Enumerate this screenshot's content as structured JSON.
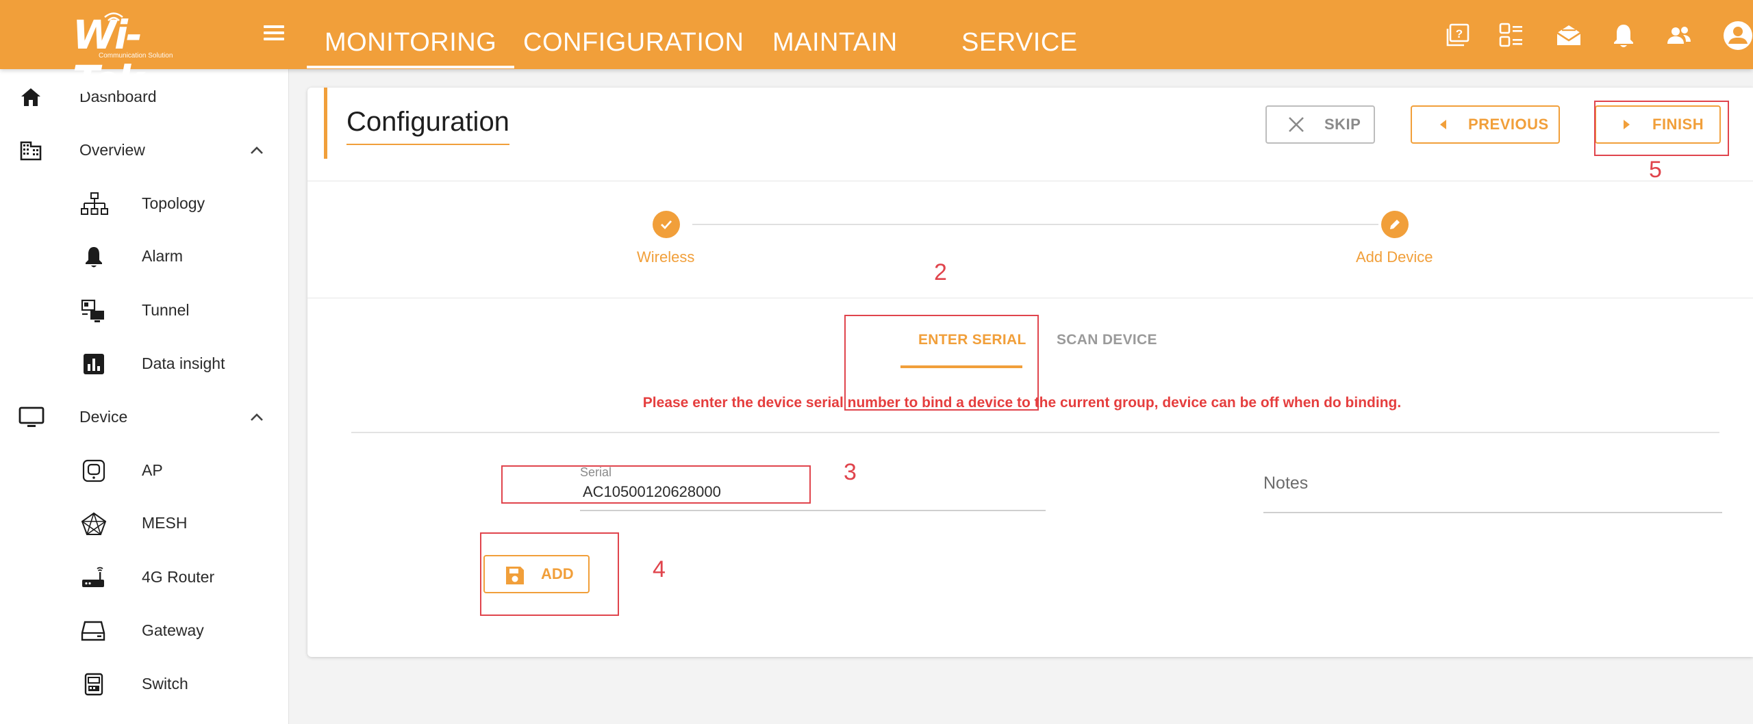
{
  "app": {
    "logo_text": "Wi-Tek",
    "logo_tagline": "Communication Solution"
  },
  "topnav": {
    "items": [
      {
        "label": "MONITORING",
        "active": true
      },
      {
        "label": "CONFIGURATION",
        "active": false
      },
      {
        "label": "MAINTAIN",
        "active": false
      },
      {
        "label": "SERVICE",
        "active": false
      }
    ],
    "icons": [
      "help-icon",
      "list-icon",
      "messages-icon",
      "bell-icon",
      "users-icon",
      "account-icon"
    ]
  },
  "sidebar": {
    "items": [
      {
        "label": "Dashboard",
        "icon": "home-icon"
      },
      {
        "label": "Overview",
        "icon": "building-icon",
        "expanded": true
      },
      {
        "label": "Topology",
        "icon": "topology-icon"
      },
      {
        "label": "Alarm",
        "icon": "bell-icon"
      },
      {
        "label": "Tunnel",
        "icon": "tunnel-icon"
      },
      {
        "label": "Data insight",
        "icon": "chart-icon"
      },
      {
        "label": "Device",
        "icon": "monitor-icon",
        "expanded": true
      },
      {
        "label": "AP",
        "icon": "ap-icon"
      },
      {
        "label": "MESH",
        "icon": "mesh-icon"
      },
      {
        "label": "4G Router",
        "icon": "router-icon"
      },
      {
        "label": "Gateway",
        "icon": "gateway-icon"
      },
      {
        "label": "Switch",
        "icon": "switch-icon"
      }
    ]
  },
  "page": {
    "title": "Configuration",
    "skip_label": "SKIP",
    "previous_label": "PREVIOUS",
    "finish_label": "FINISH"
  },
  "stepper": {
    "steps": [
      {
        "label": "Wireless",
        "state": "done"
      },
      {
        "label": "Add Device",
        "state": "editing"
      }
    ]
  },
  "tabs": {
    "items": [
      {
        "label": "ENTER SERIAL",
        "active": true
      },
      {
        "label": "SCAN DEVICE",
        "active": false
      }
    ]
  },
  "form": {
    "hint": "Please enter the device serial number to bind a device to the current group, device can be off when do binding.",
    "serial_label": "Serial",
    "serial_value": "AC10500120628000",
    "notes_placeholder": "Notes",
    "add_label": "ADD"
  },
  "annotations": [
    "2",
    "3",
    "4",
    "5"
  ],
  "colors": {
    "accent": "#f19f3a",
    "hint_red": "#e53e3e",
    "annotation_red": "#e0444c"
  }
}
